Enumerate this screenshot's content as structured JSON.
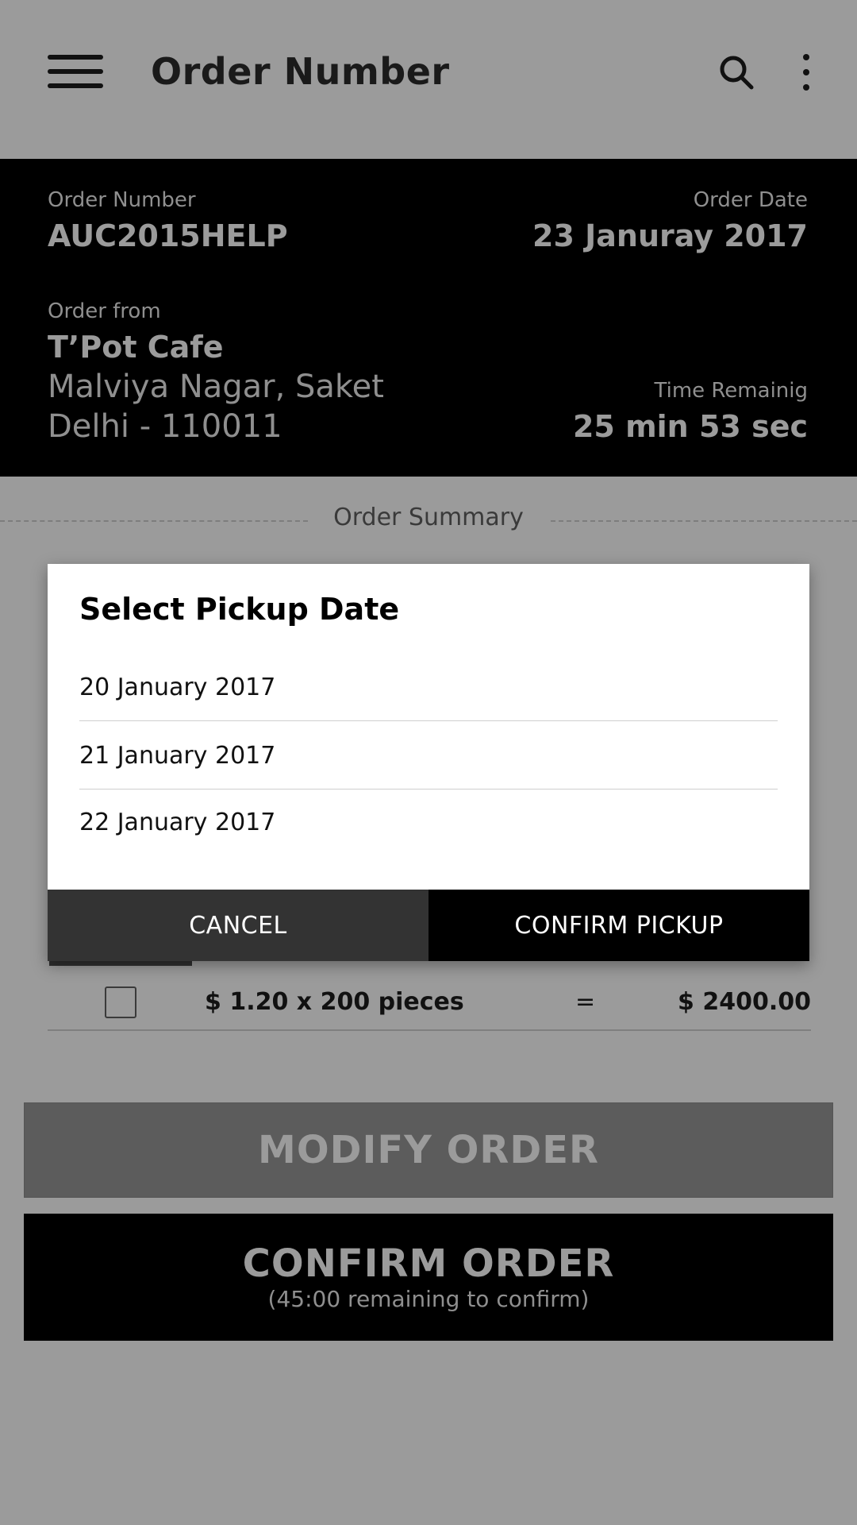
{
  "appbar": {
    "title": "Order Number",
    "icons": [
      "menu-icon",
      "search-icon",
      "more-vert-icon"
    ]
  },
  "order": {
    "number_label": "Order Number",
    "number": "AUC2015HELP",
    "date_label": "Order Date",
    "date": "23 Januray 2017",
    "from_label": "Order from",
    "from_name": "T’Pot Cafe",
    "from_address_1": "Malviya Nagar, Saket",
    "from_address_2": "Delhi - 110011",
    "time_label": "Time Remainig",
    "time_value": "25 min 53 sec"
  },
  "summary": {
    "label": "Order Summary",
    "item": {
      "price_qty": "$ 1.20 x 200 pieces",
      "equals": "=",
      "total": "$ 2400.00"
    }
  },
  "actions": {
    "modify_label": "MODIFY ORDER",
    "confirm_label": "CONFIRM ORDER",
    "confirm_sub": "(45:00 remaining to confirm)"
  },
  "dialog": {
    "title": "Select Pickup Date",
    "options": [
      "20 January 2017",
      "21 January 2017",
      "22 January 2017"
    ],
    "cancel_label": "CANCEL",
    "confirm_label": "CONFIRM PICKUP"
  },
  "colors": {
    "background": "#9b9b9b",
    "header_bg": "#000000",
    "cancel_bg": "#333333",
    "modify_bg": "#5c5c5c"
  }
}
